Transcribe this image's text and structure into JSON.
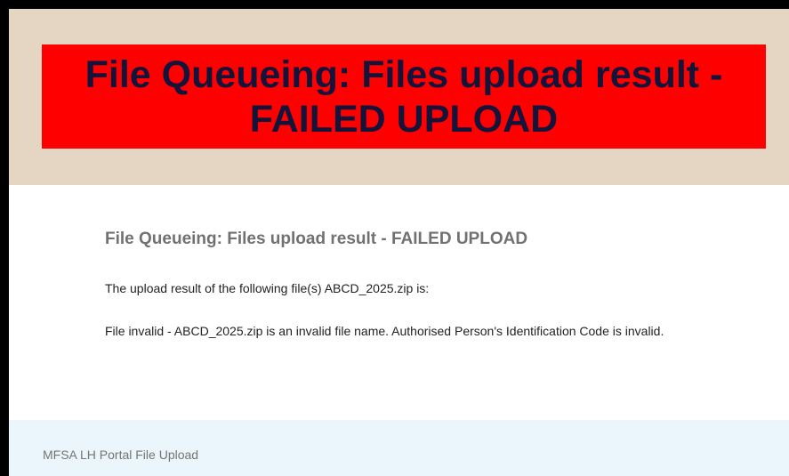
{
  "banner": {
    "title": "File Queueing: Files upload result - FAILED UPLOAD"
  },
  "content": {
    "heading": "File Queueing: Files upload result - FAILED UPLOAD",
    "paragraph_1": "The upload result of the following file(s) ABCD_2025.zip is:",
    "paragraph_2": "File invalid - ABCD_2025.zip is an invalid file name. Authorised Person's Identification Code is invalid."
  },
  "footer": {
    "text": "MFSA LH Portal File Upload"
  },
  "colors": {
    "banner_background": "#e5d6c3",
    "title_background": "#ff0000",
    "title_text": "#14143a",
    "footer_background": "#eaf6fb"
  }
}
